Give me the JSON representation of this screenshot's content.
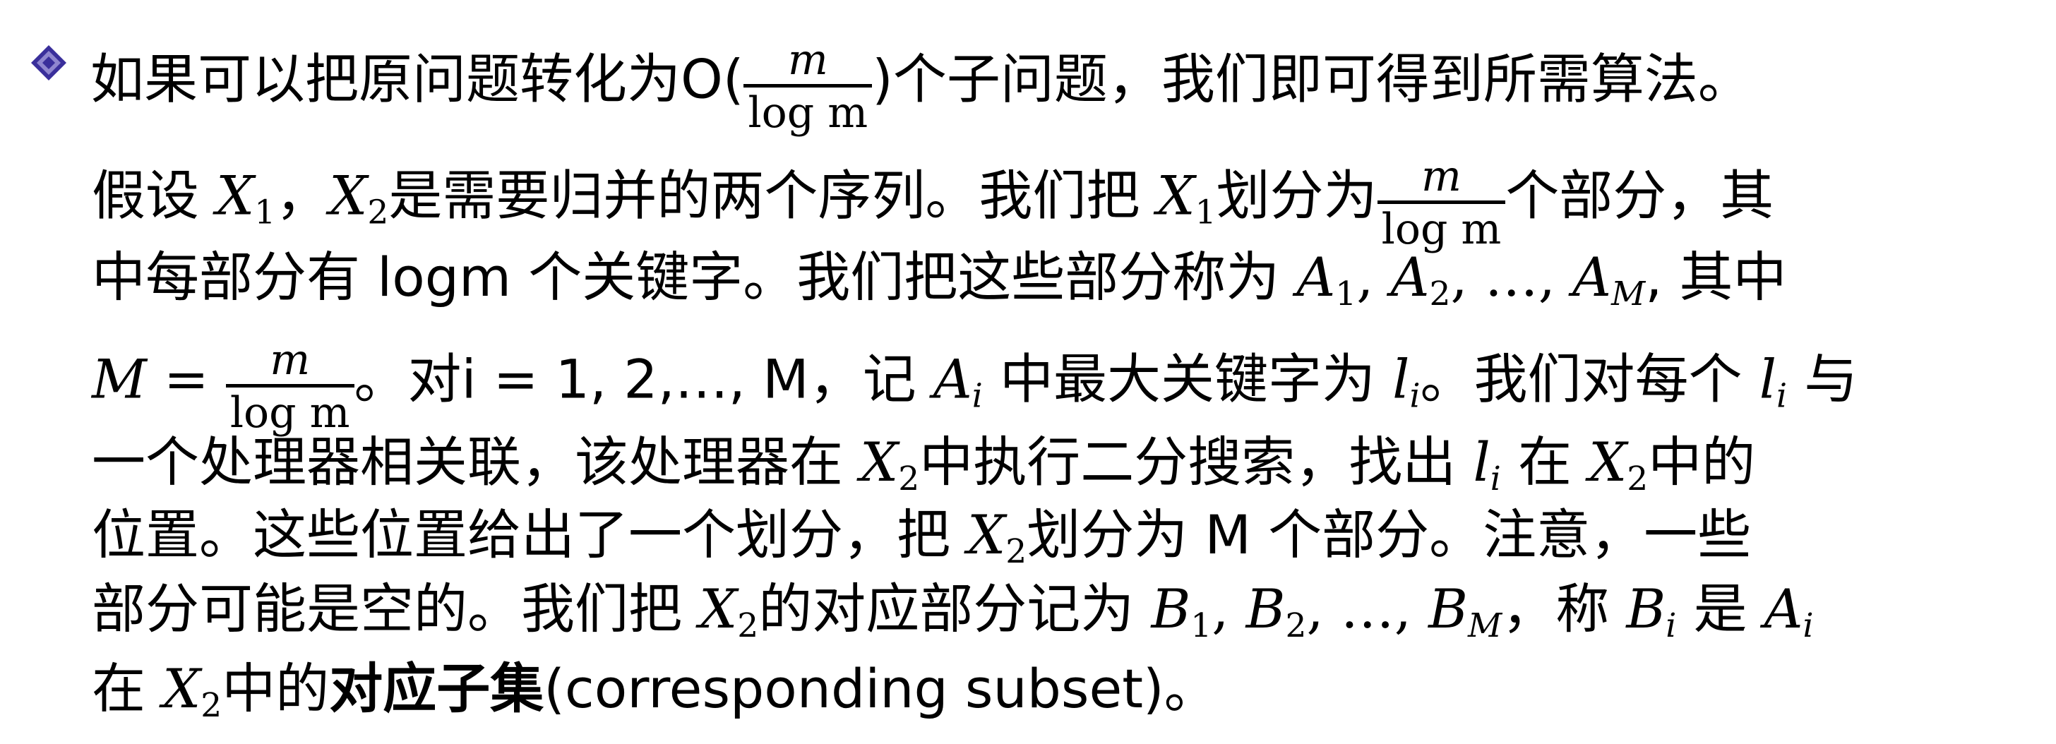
{
  "colors": {
    "bullet": "#3a2f9b",
    "text": "#000000"
  },
  "icons": {
    "bullet": "diamond-bullet-icon"
  },
  "frac": {
    "num": "m",
    "den": "log m"
  },
  "line1": {
    "t1": "如果可以把原问题转化为O(",
    "t2": ")个子问题，我们即可得到所需算法。"
  },
  "line2": {
    "t1": "假设 ",
    "x": "X",
    "s1": "1",
    "t2": "，",
    "x2": "X",
    "s2": "2",
    "t3": "是需要归并的两个序列。我们把 ",
    "x3": "X",
    "s3": "1",
    "t4": "划分为",
    "t5": "个部分，其"
  },
  "line3": {
    "t1": "中每部分有 logm 个关键字。我们把这些部分称为 ",
    "a": "A",
    "s1": "1",
    "c1": ", ",
    "a2": "A",
    "s2": "2",
    "c2": ", …, ",
    "a3": "A",
    "sM": "M",
    "t2": ", 其中"
  },
  "line4": {
    "M": "M",
    "eq": " = ",
    "t1": "。对i = 1, 2,…, M，记 ",
    "a": "A",
    "si": "i",
    "t2": " 中最大关键字为 ",
    "l": "l",
    "si2": "i",
    "t3": "。我们对每个 ",
    "l2": "l",
    "si3": "i",
    "t4": " 与"
  },
  "line5": {
    "t1": "一个处理器相关联，该处理器在 ",
    "x": "X",
    "s1": "2",
    "t2": "中执行二分搜索，找出 ",
    "l": "l",
    "si": "i",
    "t3": " 在 ",
    "x2": "X",
    "s2": "2",
    "t4": "中的"
  },
  "line6": {
    "t1": "位置。这些位置给出了一个划分，把 ",
    "x": "X",
    "s1": "2",
    "t2": "划分为 M 个部分。注意，一些"
  },
  "line7": {
    "t1": "部分可能是空的。我们把 ",
    "x": "X",
    "s1": "2",
    "t2": "的对应部分记为 ",
    "b": "B",
    "s2": "1",
    "c1": ", ",
    "b2": "B",
    "s3": "2",
    "c2": ", …, ",
    "b3": "B",
    "sM": "M",
    "t3": "，称 ",
    "b4": "B",
    "si": "i",
    "t4": " 是 ",
    "a": "A",
    "si2": "i"
  },
  "line8": {
    "t1": "在 ",
    "x": "X",
    "s1": "2",
    "t2": "中的",
    "bold": "对应子集",
    "t3": "(corresponding subset)。"
  }
}
